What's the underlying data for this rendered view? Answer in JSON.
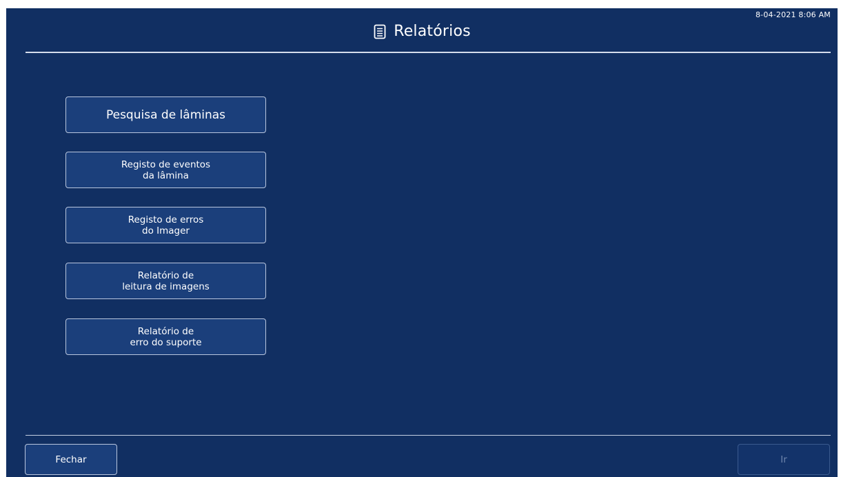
{
  "header": {
    "title": "Relatórios",
    "title_icon": "document-icon",
    "timestamp": "8-04-2021 8:06 AM"
  },
  "menu": {
    "items": [
      {
        "label": "Pesquisa de lâminas"
      },
      {
        "label": "Registo de eventos\nda lâmina"
      },
      {
        "label": "Registo de erros\ndo Imager"
      },
      {
        "label": "Relatório de\nleitura de imagens"
      },
      {
        "label": "Relatório de\nerro do suporte"
      }
    ]
  },
  "footer": {
    "close_label": "Fechar",
    "go_label": "Ir",
    "go_enabled": false
  },
  "colors": {
    "background": "#112f62",
    "button": "#1b3f7b",
    "border": "#b9c6de",
    "text": "#ffffff",
    "disabled_text": "#6f86ad"
  }
}
